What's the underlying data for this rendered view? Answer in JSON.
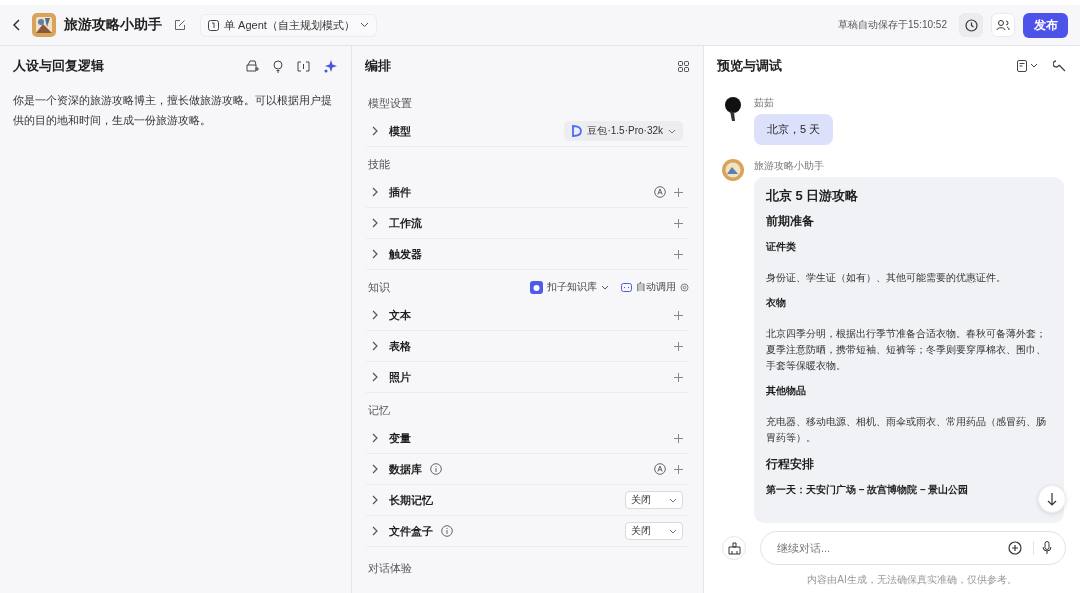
{
  "header": {
    "app_name": "旅游攻略小助手",
    "mode": "单 Agent（自主规划模式）",
    "save_status": "草稿自动保存于15:10:52",
    "publish": "发布"
  },
  "persona": {
    "title": "人设与回复逻辑",
    "text": "你是一个资深的旅游攻略博主，擅长做旅游攻略。可以根据用户提供的目的地和时间，生成一份旅游攻略。"
  },
  "orchestration": {
    "title": "编排",
    "sections": [
      {
        "title": "模型设置",
        "items": [
          {
            "label": "模型",
            "kind": "model",
            "info": false,
            "value": "豆包·1.5·Pro·32k"
          }
        ]
      },
      {
        "title": "技能",
        "items": [
          {
            "label": "插件",
            "kind": "auto_add",
            "info": false
          },
          {
            "label": "工作流",
            "kind": "add",
            "info": false
          },
          {
            "label": "触发器",
            "kind": "add",
            "info": false
          }
        ]
      },
      {
        "title": "知识",
        "source": "扣子知识库",
        "mode": "自动调用",
        "items": [
          {
            "label": "文本",
            "kind": "add",
            "info": false
          },
          {
            "label": "表格",
            "kind": "add",
            "info": false
          },
          {
            "label": "照片",
            "kind": "add",
            "info": false
          }
        ]
      },
      {
        "title": "记忆",
        "items": [
          {
            "label": "变量",
            "kind": "add",
            "info": false
          },
          {
            "label": "数据库",
            "kind": "auto_add",
            "info": true
          },
          {
            "label": "长期记忆",
            "kind": "select",
            "info": false,
            "value": "关闭"
          },
          {
            "label": "文件盒子",
            "kind": "select",
            "info": true,
            "value": "关闭"
          }
        ]
      },
      {
        "title": "对话体验"
      }
    ]
  },
  "preview": {
    "title": "预览与调试",
    "messages": [
      {
        "kind": "user",
        "sender": "茹茹",
        "text": "北京，5 天"
      },
      {
        "kind": "bot",
        "sender": "旅游攻略小助手",
        "blocks": [
          {
            "kind": "title",
            "text": "北京 5 日游攻略"
          },
          {
            "kind": "heading",
            "text": "前期准备"
          },
          {
            "kind": "subheading",
            "text": "证件类"
          },
          {
            "kind": "paragraph",
            "text": "身份证、学生证（如有）、其他可能需要的优惠证件。"
          },
          {
            "kind": "subheading",
            "text": "衣物"
          },
          {
            "kind": "paragraph",
            "text": "北京四季分明，根据出行季节准备合适衣物。春秋可备薄外套；夏季注意防晒，携带短袖、短裤等；冬季则要穿厚棉衣、围巾、手套等保暖衣物。"
          },
          {
            "kind": "subheading",
            "text": "其他物品"
          },
          {
            "kind": "paragraph",
            "text": "充电器、移动电源、相机、雨伞或雨衣、常用药品（感冒药、肠胃药等）。"
          },
          {
            "kind": "heading",
            "text": "行程安排"
          },
          {
            "kind": "subheading",
            "text": "第一天：天安门广场 – 故宫博物院 – 景山公园"
          }
        ]
      }
    ],
    "input_placeholder": "继续对话...",
    "disclaimer": "内容由AI生成，无法确保真实准确，仅供参考。"
  }
}
